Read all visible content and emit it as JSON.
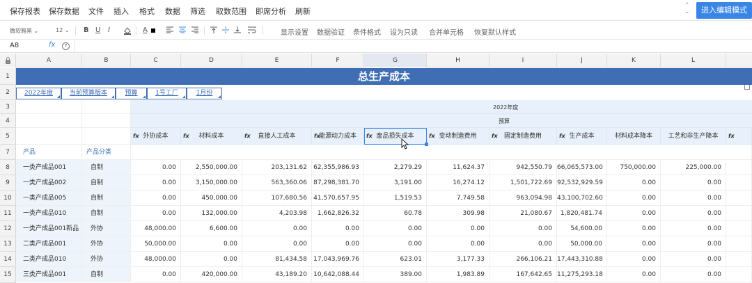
{
  "menubar": {
    "items": [
      "保存报表",
      "保存数据",
      "文件",
      "插入",
      "格式",
      "数据",
      "筛选",
      "取数范围",
      "即席分析",
      "刷新"
    ],
    "edit_mode_button": "进入编辑模式"
  },
  "toolbar": {
    "font_name": "微软雅黑",
    "font_size": "12",
    "bold": "B",
    "underline": "U",
    "italic": "I",
    "font_color": "A",
    "text_buttons": [
      "显示设置",
      "数据验证",
      "条件格式",
      "设为只读",
      "合并单元格",
      "恢复默认样式"
    ]
  },
  "formula_bar": {
    "cell_ref": "A8",
    "fx": "fx",
    "value": ""
  },
  "column_headers": [
    "A",
    "B",
    "C",
    "D",
    "E",
    "F",
    "G",
    "H",
    "I",
    "J",
    "K",
    "L"
  ],
  "row_headers": [
    "1",
    "2",
    "3",
    "4",
    "5",
    "7",
    "8",
    "9",
    "10",
    "11",
    "12",
    "13",
    "14",
    "15"
  ],
  "sheet": {
    "title": "总生产成本",
    "filters": [
      "2022年度",
      "当前预算版本",
      "预算",
      "1号工厂",
      "1月份"
    ],
    "year_label": "2022年度",
    "budget_label": "预算",
    "measure_headers": [
      "外协成本",
      "材料成本",
      "直接人工成本",
      "能源动力成本",
      "废品损失成本",
      "变动制造费用",
      "固定制造费用",
      "生产成本",
      "材料成本降本",
      "工艺和非生产降本"
    ],
    "dim_headers": [
      "产品",
      "产品分类"
    ]
  },
  "table": {
    "rows": [
      {
        "product": "一类产成品001",
        "category": "自制",
        "values": [
          "0.00",
          "2,550,000.00",
          "203,131.62",
          "62,355,986.93",
          "2,279.29",
          "11,624.37",
          "942,550.79",
          "66,065,573.00",
          "750,000.00",
          "225,000.00"
        ]
      },
      {
        "product": "一类产成品002",
        "category": "自制",
        "values": [
          "0.00",
          "3,150,000.00",
          "563,360.06",
          "87,298,381.70",
          "3,191.00",
          "16,274.12",
          "1,501,722.69",
          "92,532,929.59",
          "0.00",
          "0.00"
        ]
      },
      {
        "product": "一类产成品005",
        "category": "自制",
        "values": [
          "0.00",
          "450,000.00",
          "107,680.56",
          "41,570,657.95",
          "1,519.53",
          "7,749.58",
          "963,094.98",
          "43,100,702.60",
          "0.00",
          "0.00"
        ]
      },
      {
        "product": "一类产成品010",
        "category": "自制",
        "values": [
          "0.00",
          "132,000.00",
          "4,203.98",
          "1,662,826.32",
          "60.78",
          "309.98",
          "21,080.67",
          "1,820,481.74",
          "0.00",
          "0.00"
        ]
      },
      {
        "product": "一类产成品001新品",
        "category": "外协",
        "values": [
          "48,000.00",
          "6,600.00",
          "0.00",
          "0.00",
          "0.00",
          "0.00",
          "0.00",
          "54,600.00",
          "0.00",
          "0.00"
        ]
      },
      {
        "product": "二类产成品001",
        "category": "外协",
        "values": [
          "50,000.00",
          "0.00",
          "0.00",
          "0.00",
          "0.00",
          "0.00",
          "0.00",
          "50,000.00",
          "0.00",
          "0.00"
        ]
      },
      {
        "product": "二类产成品010",
        "category": "外协",
        "values": [
          "48,000.00",
          "0.00",
          "81,434.58",
          "17,043,969.76",
          "623.01",
          "3,177.33",
          "266,106.21",
          "17,443,310.88",
          "0.00",
          "0.00"
        ]
      },
      {
        "product": "三类产成品001",
        "category": "自制",
        "values": [
          "0.00",
          "420,000.00",
          "43,189.20",
          "10,642,088.44",
          "389.00",
          "1,983.89",
          "167,642.65",
          "11,275,293.18",
          "0.00",
          "0.00"
        ]
      }
    ]
  }
}
